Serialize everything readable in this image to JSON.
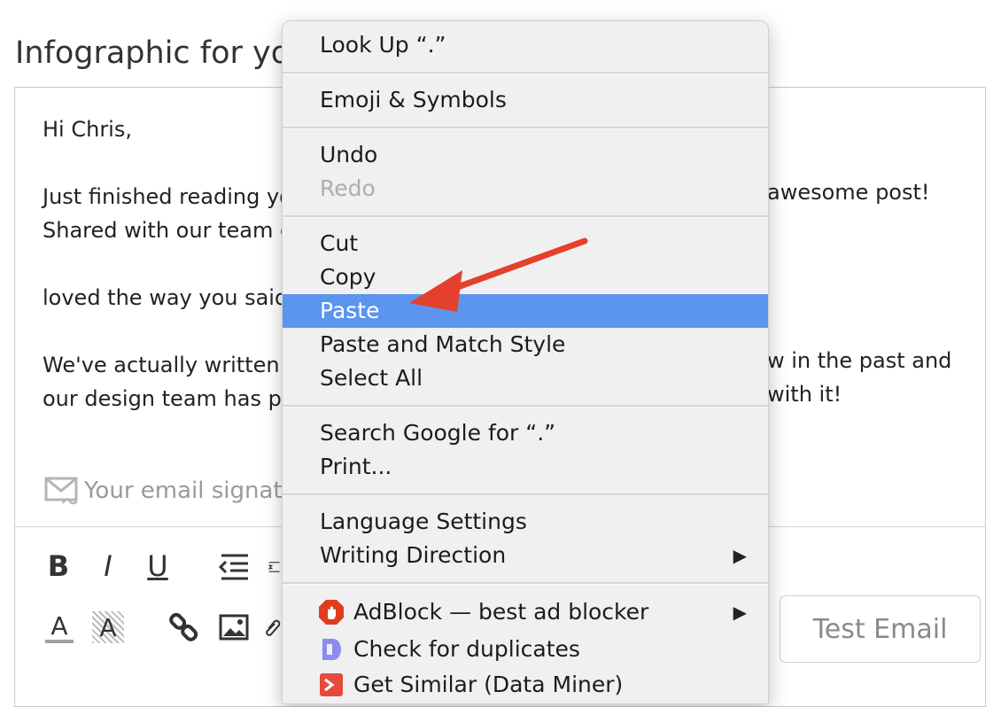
{
  "subject": "Infographic for yo",
  "body_lines": [
    "Hi Chris,",
    "",
    "Just finished reading yo",
    "Shared with our team o",
    "",
    "loved the way you said",
    "",
    "We've actually written a",
    "our design team has pu"
  ],
  "body_right_fragments": {
    "line1": "awesome post!",
    "line2": "w in the past and",
    "line3": "with it!"
  },
  "signature_placeholder": "Your email signatu",
  "test_email_button": "Test Email",
  "toolbar_icons": [
    "bold-icon",
    "italic-icon",
    "underline-icon",
    "outdent-icon",
    "indent-icon",
    "text-color-icon",
    "highlight-icon",
    "link-icon",
    "image-icon",
    "attach-icon"
  ],
  "toolbar_glyphs": {
    "bold": "B",
    "italic": "I",
    "underline": "U",
    "text_color": "A",
    "highlight": "A"
  },
  "context_menu": {
    "look_up": "Look Up “.”",
    "emoji": "Emoji & Symbols",
    "undo": "Undo",
    "redo": "Redo",
    "cut": "Cut",
    "copy": "Copy",
    "paste": "Paste",
    "paste_match": "Paste and Match Style",
    "select_all": "Select All",
    "search_google": "Search Google for “.”",
    "print": "Print...",
    "language_settings": "Language Settings",
    "writing_direction": "Writing Direction",
    "adblock": "AdBlock — best ad blocker",
    "check_duplicates": "Check for duplicates",
    "get_similar": "Get Similar (Data Miner)"
  },
  "colors": {
    "highlight": "#5b95ee",
    "arrow": "#e5402b",
    "adblock": "#e03c1f",
    "duplicates": "#8b8bf0"
  }
}
